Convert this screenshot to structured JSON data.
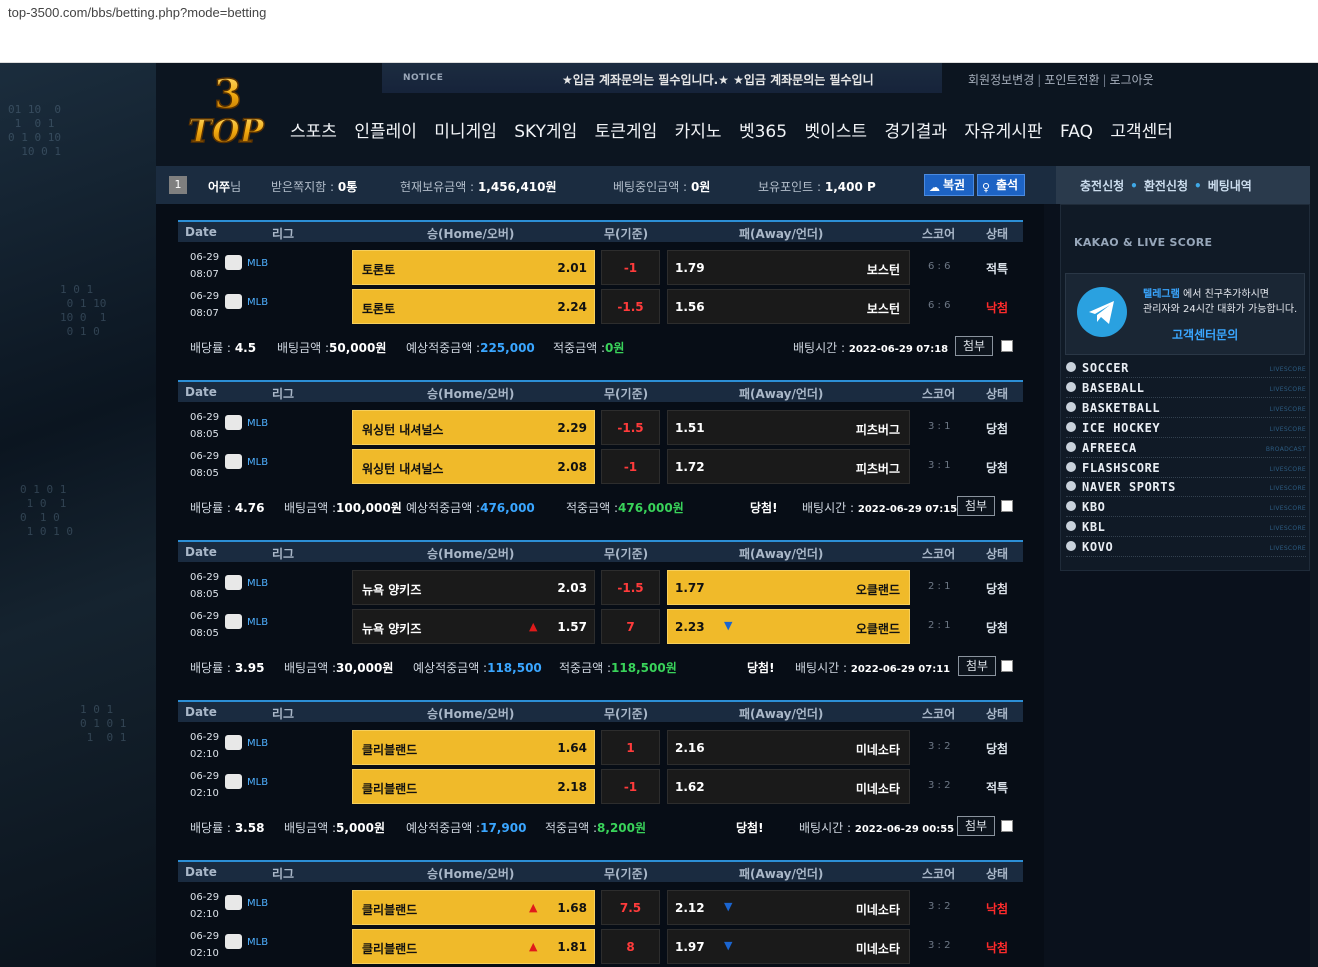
{
  "url": "top-3500.com/bbs/betting.php?mode=betting",
  "logo": {
    "text_top": "3",
    "text_bottom": "TOP"
  },
  "notice": {
    "label": "NOTICE",
    "text": "★입금 계좌문의는 필수입니다.★ ★입금 계좌문의는 필수입니"
  },
  "top_links": [
    "회원정보변경",
    "포인트전환",
    "로그아웃"
  ],
  "nav": [
    "스포츠",
    "인플레이",
    "미니게임",
    "SKY게임",
    "토큰게임",
    "카지노",
    "벳365",
    "벳이스트",
    "경기결과",
    "자유게시판",
    "FAQ",
    "고객센터"
  ],
  "user": {
    "level": "1",
    "name": "어쭈",
    "name_suffix": "님",
    "msg_label": "받은쪽지함 :",
    "msg_value": "0통",
    "balance_label": "현재보유금액 :",
    "balance_value": "1,456,410원",
    "betting_label": "베팅중인금액 :",
    "betting_value": "0원",
    "point_label": "보유포인트 :",
    "point_value": "1,400 P",
    "btn_bokgwon": "복권",
    "btn_check": "출석"
  },
  "side_links": [
    "충전신청",
    "환전신청",
    "베팅내역"
  ],
  "side": {
    "title": "KAKAO & LIVE SCORE",
    "tg_hl": "텔레그램",
    "tg_line1": " 에서 친구추가하시면",
    "tg_line2": "관리자와 24시간 대화가 가능합니다.",
    "tg_link": "고객센터문의",
    "live": [
      {
        "name": "SOCCER",
        "tag": "LIVESCORE"
      },
      {
        "name": "BASEBALL",
        "tag": "LIVESCORE"
      },
      {
        "name": "BASKETBALL",
        "tag": "LIVESCORE"
      },
      {
        "name": "ICE HOCKEY",
        "tag": "LIVESCORE"
      },
      {
        "name": "AFREECA",
        "tag": "BROADCAST"
      },
      {
        "name": "FLASHSCORE",
        "tag": "LIVESCORE"
      },
      {
        "name": "NAVER SPORTS",
        "tag": "LIVESCORE"
      },
      {
        "name": "KBO",
        "tag": "LIVESCORE"
      },
      {
        "name": "KBL",
        "tag": "LIVESCORE"
      },
      {
        "name": "KOVO",
        "tag": "LIVESCORE"
      }
    ]
  },
  "headers": {
    "date": "Date",
    "league": "리그",
    "home": "승(Home/오버)",
    "draw": "무(기준)",
    "away": "패(Away/언더)",
    "score": "스코어",
    "status": "상태"
  },
  "labels": {
    "odds": "배당률 :",
    "bet": "배팅금액 :",
    "expected": "예상적중금액 :",
    "hit": "적중금액 :",
    "time": "배팅시간 :",
    "attach": "첨부"
  },
  "slips": [
    {
      "games": [
        {
          "date": "06-29",
          "time": "08:07",
          "league": "MLB",
          "home": "토론토",
          "home_odd": "2.01",
          "draw": "-1",
          "away_odd": "1.79",
          "away": "보스턴",
          "score": "6 : 6",
          "status": "적특",
          "lose": false,
          "sel": "home",
          "home_arrow": "",
          "away_arrow": ""
        },
        {
          "date": "06-29",
          "time": "08:07",
          "league": "MLB",
          "home": "토론토",
          "home_odd": "2.24",
          "draw": "-1.5",
          "away_odd": "1.56",
          "away": "보스턴",
          "score": "6 : 6",
          "status": "낙첨",
          "lose": true,
          "sel": "home",
          "home_arrow": "",
          "away_arrow": ""
        }
      ],
      "odds": "4.5",
      "bet": "50,000원",
      "expected": "225,000",
      "hit": "0원",
      "win": "",
      "time": "2022-06-29 07:18"
    },
    {
      "games": [
        {
          "date": "06-29",
          "time": "08:05",
          "league": "MLB",
          "home": "워싱턴 내셔널스",
          "home_odd": "2.29",
          "draw": "-1.5",
          "away_odd": "1.51",
          "away": "피츠버그",
          "score": "3 : 1",
          "status": "당첨",
          "lose": false,
          "sel": "home",
          "home_arrow": "",
          "away_arrow": ""
        },
        {
          "date": "06-29",
          "time": "08:05",
          "league": "MLB",
          "home": "워싱턴 내셔널스",
          "home_odd": "2.08",
          "draw": "-1",
          "away_odd": "1.72",
          "away": "피츠버그",
          "score": "3 : 1",
          "status": "당첨",
          "lose": false,
          "sel": "home",
          "home_arrow": "",
          "away_arrow": ""
        }
      ],
      "odds": "4.76",
      "bet": "100,000원",
      "expected": "476,000",
      "hit": "476,000원",
      "win": "당첨!",
      "time": "2022-06-29 07:15"
    },
    {
      "games": [
        {
          "date": "06-29",
          "time": "08:05",
          "league": "MLB",
          "home": "뉴욕 양키즈",
          "home_odd": "2.03",
          "draw": "-1.5",
          "away_odd": "1.77",
          "away": "오클랜드",
          "score": "2 : 1",
          "status": "당첨",
          "lose": false,
          "sel": "away",
          "home_arrow": "",
          "away_arrow": ""
        },
        {
          "date": "06-29",
          "time": "08:05",
          "league": "MLB",
          "home": "뉴욕 양키즈",
          "home_odd": "1.57",
          "draw": "7",
          "away_odd": "2.23",
          "away": "오클랜드",
          "score": "2 : 1",
          "status": "당첨",
          "lose": false,
          "sel": "away",
          "home_arrow": "up",
          "away_arrow": "down"
        }
      ],
      "odds": "3.95",
      "bet": "30,000원",
      "expected": "118,500",
      "hit": "118,500원",
      "win": "당첨!",
      "time": "2022-06-29 07:11"
    },
    {
      "games": [
        {
          "date": "06-29",
          "time": "02:10",
          "league": "MLB",
          "home": "클리블랜드",
          "home_odd": "1.64",
          "draw": "1",
          "away_odd": "2.16",
          "away": "미네소타",
          "score": "3 : 2",
          "status": "당첨",
          "lose": false,
          "sel": "home",
          "home_arrow": "",
          "away_arrow": ""
        },
        {
          "date": "06-29",
          "time": "02:10",
          "league": "MLB",
          "home": "클리블랜드",
          "home_odd": "2.18",
          "draw": "-1",
          "away_odd": "1.62",
          "away": "미네소타",
          "score": "3 : 2",
          "status": "적특",
          "lose": false,
          "sel": "home",
          "home_arrow": "",
          "away_arrow": ""
        }
      ],
      "odds": "3.58",
      "bet": "5,000원",
      "expected": "17,900",
      "hit": "8,200원",
      "win": "당첨!",
      "time": "2022-06-29 00:55"
    },
    {
      "games": [
        {
          "date": "06-29",
          "time": "02:10",
          "league": "MLB",
          "home": "클리블랜드",
          "home_odd": "1.68",
          "draw": "7.5",
          "away_odd": "2.12",
          "away": "미네소타",
          "score": "3 : 2",
          "status": "낙첨",
          "lose": true,
          "sel": "home",
          "home_arrow": "up",
          "away_arrow": "down"
        },
        {
          "date": "06-29",
          "time": "02:10",
          "league": "MLB",
          "home": "클리블랜드",
          "home_odd": "1.81",
          "draw": "8",
          "away_odd": "1.97",
          "away": "미네소타",
          "score": "3 : 2",
          "status": "낙첨",
          "lose": true,
          "sel": "home",
          "home_arrow": "up",
          "away_arrow": "down"
        }
      ]
    }
  ]
}
